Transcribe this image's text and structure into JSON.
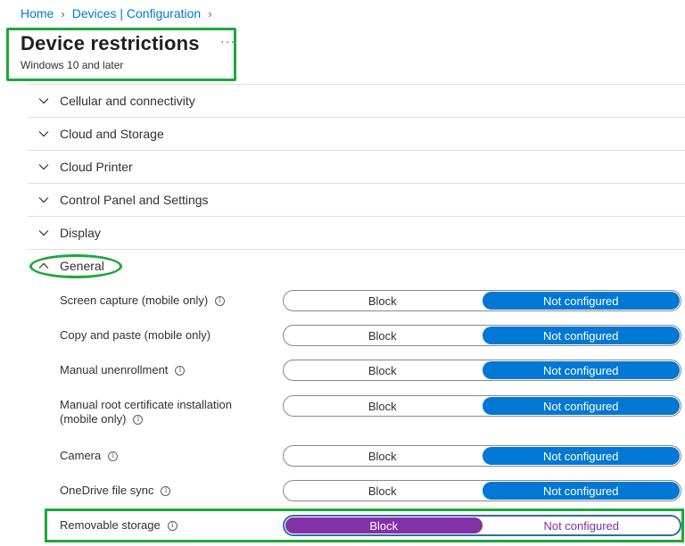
{
  "breadcrumb": {
    "home": "Home",
    "section": "Devices | Configuration"
  },
  "header": {
    "title": "Device restrictions",
    "subtitle": "Windows 10 and later",
    "more": "···"
  },
  "accordion": {
    "items": [
      {
        "label": "Cellular and connectivity",
        "expanded": false
      },
      {
        "label": "Cloud and Storage",
        "expanded": false
      },
      {
        "label": "Cloud Printer",
        "expanded": false
      },
      {
        "label": "Control Panel and Settings",
        "expanded": false
      },
      {
        "label": "Display",
        "expanded": false
      },
      {
        "label": "General",
        "expanded": true
      }
    ]
  },
  "settings": {
    "options": {
      "block": "Block",
      "not_configured": "Not configured"
    },
    "items": [
      {
        "label": "Screen capture (mobile only)",
        "selected": "Not configured",
        "info": true
      },
      {
        "label": "Copy and paste (mobile only)",
        "selected": "Not configured",
        "info": false
      },
      {
        "label": "Manual unenrollment",
        "selected": "Not configured",
        "info": true
      },
      {
        "label_line1": "Manual root certificate installation",
        "label_line2": "(mobile only)",
        "selected": "Not configured",
        "info": true
      },
      {
        "label": "Camera",
        "selected": "Not configured",
        "info": true
      },
      {
        "label": "OneDrive file sync",
        "selected": "Not configured",
        "info": true
      },
      {
        "label": "Removable storage",
        "selected": "Block",
        "info": true
      }
    ]
  },
  "colors": {
    "accent": "#0078d4",
    "selected_block": "#8430a8",
    "highlight": "#1ea83a"
  },
  "icons": {
    "chevron": "chevron-down-icon",
    "chevron_expanded": "chevron-up-icon",
    "info": "info-icon"
  }
}
